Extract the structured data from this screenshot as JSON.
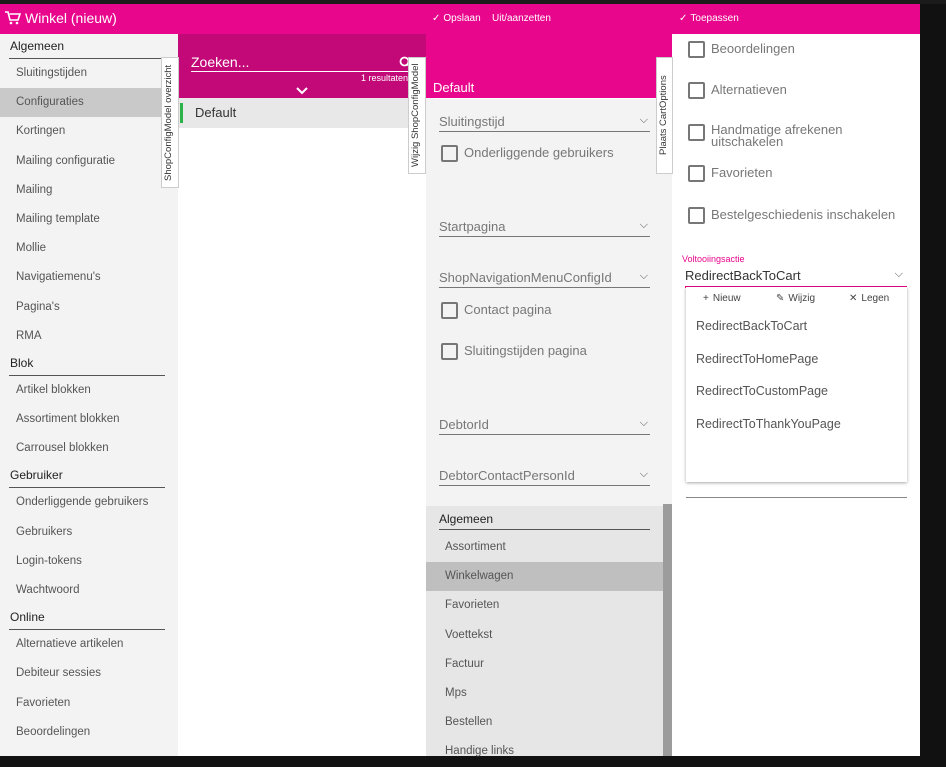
{
  "header": {
    "title": "Winkel (nieuw)",
    "save_label": "Opslaan",
    "toggle_label": "Uit/aanzetten",
    "apply_label": "Toepassen"
  },
  "nav": {
    "groups": [
      {
        "label": "Algemeen",
        "items": [
          "Sluitingstijden",
          "Configuraties",
          "Kortingen",
          "Mailing configuratie",
          "Mailing",
          "Mailing template",
          "Mollie",
          "Navigatiemenu's",
          "Pagina's",
          "RMA"
        ],
        "selected": 1
      },
      {
        "label": "Blok",
        "items": [
          "Artikel blokken",
          "Assortiment blokken",
          "Carrousel blokken"
        ],
        "selected": -1
      },
      {
        "label": "Gebruiker",
        "items": [
          "Onderliggende gebruikers",
          "Gebruikers",
          "Login-tokens",
          "Wachtwoord"
        ],
        "selected": -1
      },
      {
        "label": "Online",
        "items": [
          "Alternatieve artikelen",
          "Debiteur sessies",
          "Favorieten",
          "Beoordelingen"
        ],
        "selected": -1
      }
    ]
  },
  "list_panel": {
    "search_placeholder": "Zoeken...",
    "results": "1 resultaten",
    "rows": [
      "Default"
    ],
    "tab_label": "ShopConfigModel overzicht"
  },
  "edit_panel": {
    "tab_label": "Wijzig ShopConfigModel",
    "name": "Default",
    "fields": {
      "sluitingstijd": "Sluitingstijd",
      "onderliggende": "Onderliggende gebruikers",
      "startpagina": "Startpagina",
      "navmenu": "ShopNavigationMenuConfigId",
      "contact": "Contact pagina",
      "sluitingstijden_pagina": "Sluitingstijden pagina",
      "debtor": "DebtorId",
      "debtor_contact": "DebtorContactPersonId"
    },
    "section_title": "Algemeen",
    "sections": [
      "Assortiment",
      "Winkelwagen",
      "Favorieten",
      "Voettekst",
      "Factuur",
      "Mps",
      "Bestellen",
      "Handige links"
    ],
    "selected_section": 1
  },
  "cart_panel": {
    "tab_label": "Plaats CartOptions",
    "checks": [
      "Beoordelingen",
      "Alternatieven",
      "Handmatige afrekenen uitschakelen",
      "Favorieten",
      "Bestelgeschiedenis inschakelen"
    ],
    "completion_label": "Voltooiingsactie",
    "completion_value": "RedirectBackToCart",
    "tools": {
      "new": "Nieuw",
      "edit": "Wijzig",
      "clear": "Legen"
    },
    "options": [
      "RedirectBackToCart",
      "RedirectToHomePage",
      "RedirectToCustomPage",
      "RedirectToThankYouPage"
    ]
  },
  "colors": {
    "accent": "#e8078c",
    "accent_dark": "#c30978",
    "selected_marker": "#2db34a"
  }
}
